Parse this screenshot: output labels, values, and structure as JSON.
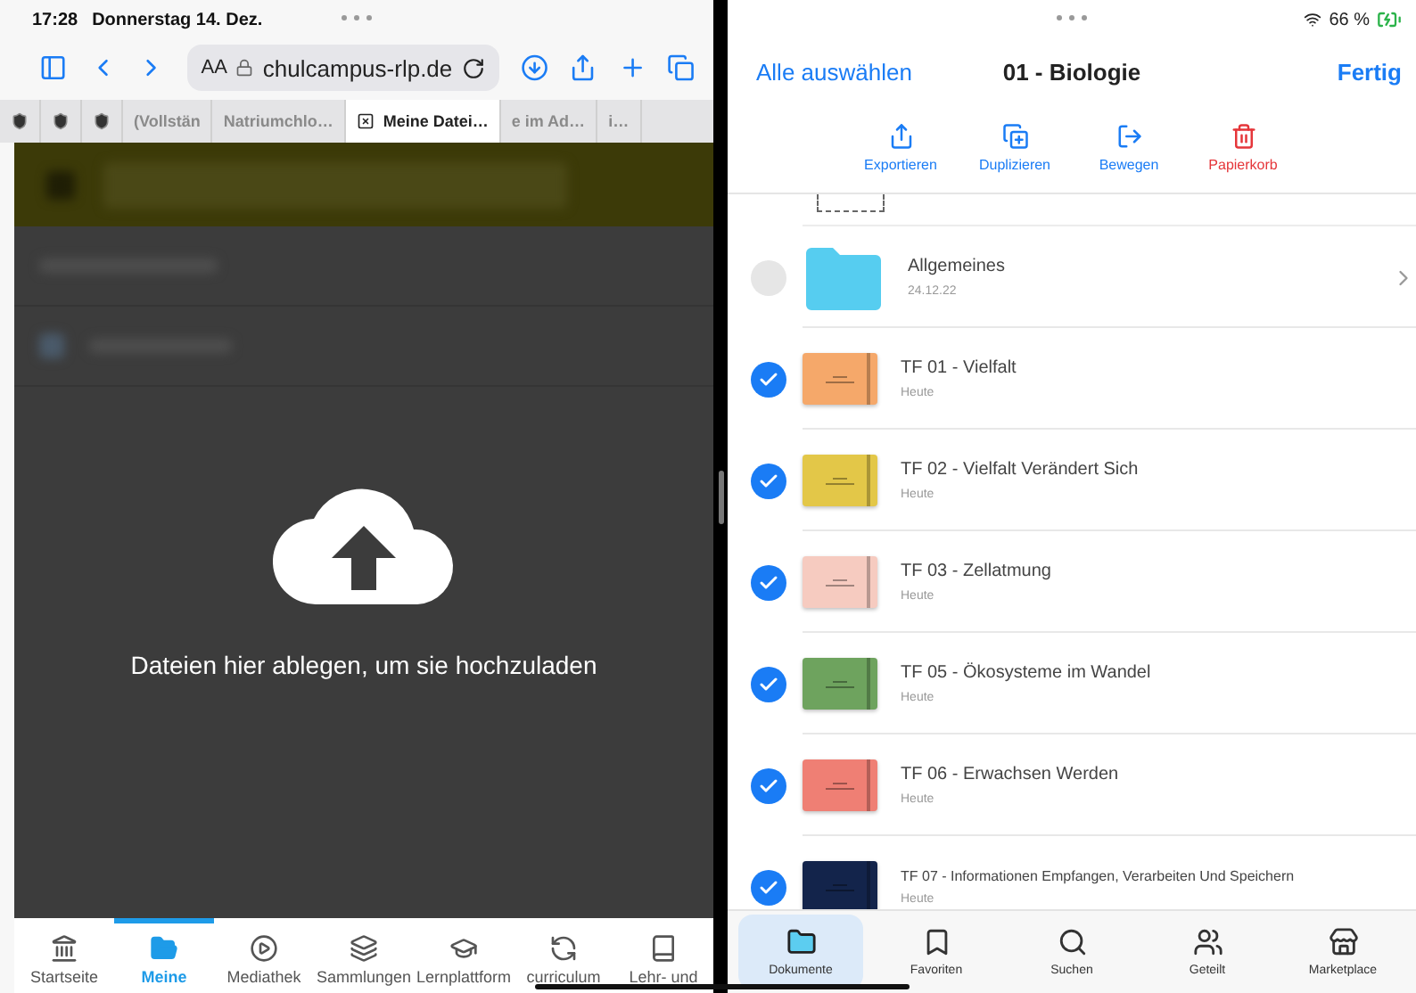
{
  "left_pane": {
    "status_bar": {
      "time": "17:28",
      "date": "Donnerstag 14. Dez."
    },
    "address_bar": {
      "text_size": "AA",
      "url": "chulcampus-rlp.de"
    },
    "tabs": [
      {
        "kind": "pinned",
        "selected": false
      },
      {
        "kind": "pinned",
        "selected": false
      },
      {
        "kind": "pinned",
        "selected": false
      },
      {
        "kind": "page",
        "title": "(Vollstän",
        "selected": false
      },
      {
        "kind": "page",
        "title": "Natriumchlo…",
        "selected": false
      },
      {
        "kind": "page",
        "title": "Meine Datei…",
        "selected": true
      },
      {
        "kind": "page",
        "title": "e im Ad…",
        "selected": false
      },
      {
        "kind": "page",
        "title": "i…",
        "selected": false
      }
    ],
    "drop_zone": {
      "message": "Dateien hier ablegen, um sie hochzuladen"
    },
    "bottom_nav": [
      {
        "label": "Startseite",
        "selected": false
      },
      {
        "label": "Meine",
        "selected": true
      },
      {
        "label": "Mediathek",
        "selected": false
      },
      {
        "label": "Sammlungen",
        "selected": false
      },
      {
        "label": "Lernplattform",
        "selected": false
      },
      {
        "label": "curriculum",
        "selected": false
      },
      {
        "label": "Lehr- und",
        "selected": false
      }
    ]
  },
  "right_pane": {
    "status_bar": {
      "battery": "66 %"
    },
    "header": {
      "left_action": "Alle auswählen",
      "title": "01 - Biologie",
      "right_action": "Fertig"
    },
    "actions": [
      {
        "label": "Exportieren",
        "kind": "share"
      },
      {
        "label": "Duplizieren",
        "kind": "duplicate"
      },
      {
        "label": "Bewegen",
        "kind": "move"
      },
      {
        "label": "Papierkorb",
        "kind": "trash"
      }
    ],
    "items": [
      {
        "kind": "folder",
        "name": "Allgemeines",
        "date": "24.12.22",
        "selected": false
      },
      {
        "kind": "notebook",
        "name": "TF 01 - Vielfalt",
        "date": "Heute",
        "selected": true,
        "color": "#f5a86a"
      },
      {
        "kind": "notebook",
        "name": "TF 02 - Vielfalt Verändert Sich",
        "date": "Heute",
        "selected": true,
        "color": "#e3c748"
      },
      {
        "kind": "notebook",
        "name": "TF 03 - Zellatmung",
        "date": "Heute",
        "selected": true,
        "color": "#f6cbc0"
      },
      {
        "kind": "notebook",
        "name": "TF 05 - Ökosysteme im Wandel",
        "date": "Heute",
        "selected": true,
        "color": "#6ea35e"
      },
      {
        "kind": "notebook",
        "name": "TF 06 - Erwachsen Werden",
        "date": "Heute",
        "selected": true,
        "color": "#ef7f74"
      },
      {
        "kind": "notebook",
        "name": "TF 07 - Informationen Empfangen, Verarbeiten Und Speichern",
        "date": "Heute",
        "selected": true,
        "color": "#13244b"
      }
    ],
    "tabs": [
      {
        "label": "Dokumente",
        "selected": true
      },
      {
        "label": "Favoriten",
        "selected": false
      },
      {
        "label": "Suchen",
        "selected": false
      },
      {
        "label": "Geteilt",
        "selected": false
      },
      {
        "label": "Marketplace",
        "selected": false
      }
    ]
  }
}
